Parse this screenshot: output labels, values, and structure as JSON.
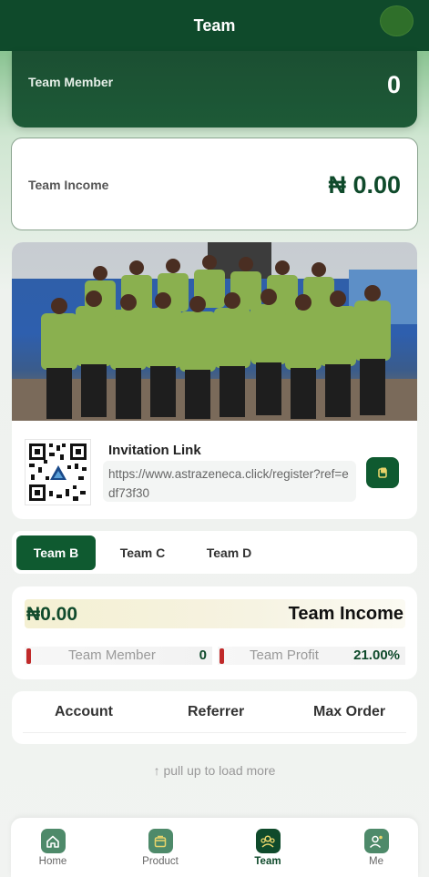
{
  "header": {
    "title": "Team"
  },
  "summary": {
    "team_member_label": "Team Member",
    "team_member_value": "0",
    "team_income_label": "Team Income",
    "team_income_value": "₦ 0.00"
  },
  "invite": {
    "title": "Invitation Link",
    "link": "https://www.astrazeneca.click/register?ref=edf73f30"
  },
  "tabs": [
    {
      "label": "Team B",
      "active": true
    },
    {
      "label": "Team C",
      "active": false
    },
    {
      "label": "Team D",
      "active": false
    }
  ],
  "stats": {
    "amount": "₦0.00",
    "title": "Team Income",
    "member_label": "Team Member",
    "member_value": "0",
    "profit_label": "Team Profit",
    "profit_value": "21.00%"
  },
  "table": {
    "columns": [
      "Account",
      "Referrer",
      "Max Order"
    ]
  },
  "pull_more": "↑ pull up to load more",
  "nav": [
    {
      "label": "Home",
      "icon": "home-icon"
    },
    {
      "label": "Product",
      "icon": "product-icon"
    },
    {
      "label": "Team",
      "icon": "team-icon",
      "active": true
    },
    {
      "label": "Me",
      "icon": "me-icon"
    }
  ],
  "colors": {
    "primary": "#0f4a2b",
    "accent_button": "#0f5a30",
    "alert_bar": "#c02a2a"
  }
}
